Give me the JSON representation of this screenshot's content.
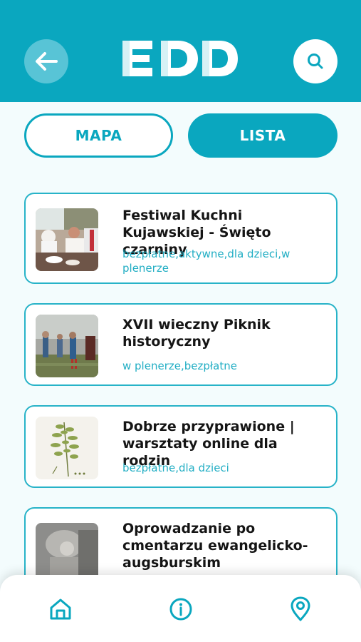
{
  "header": {
    "logo_text": "EDD",
    "back_icon": "arrow-left-icon",
    "search_icon": "search-icon"
  },
  "view_toggle": {
    "map_label": "MAPA",
    "list_label": "LISTA",
    "active": "LISTA"
  },
  "events": [
    {
      "title": "Festiwal Kuchni Kujawskiej - Święto czarniny",
      "tags": "bezpłatne,aktywne,dla dzieci,w plenerze"
    },
    {
      "title": "XVII wieczny Piknik historyczny",
      "tags": "w plenerze,bezpłatne"
    },
    {
      "title": "Dobrze przyprawione | warsztaty online dla rodzin",
      "tags": "bezpłatne,dla dzieci"
    },
    {
      "title": "Oprowadzanie po cmentarzu ewangelicko-augsburskim",
      "tags": ""
    }
  ],
  "bottom_nav": {
    "items": [
      "home-icon",
      "info-icon",
      "location-pin-icon"
    ]
  },
  "colors": {
    "primary": "#0aa7bf",
    "primary_light": "#58c4d6",
    "background": "#f3fcfd",
    "tag_text": "#22aec4"
  }
}
